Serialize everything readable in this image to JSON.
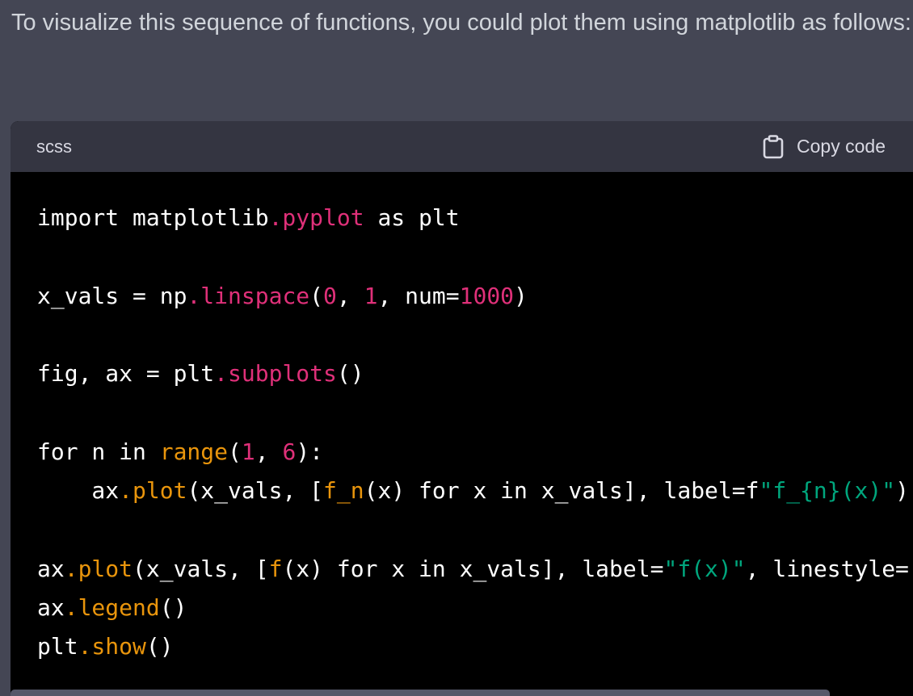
{
  "message": {
    "intro_text": "To visualize this sequence of functions, you could plot them using matplotlib as follows:"
  },
  "code_block": {
    "language": "scss",
    "copy_label": "Copy code",
    "copy_icon": "clipboard-icon",
    "lines": [
      [
        {
          "t": "import matplotlib",
          "c": ""
        },
        {
          "t": ".pyplot",
          "c": "fn"
        },
        {
          "t": " as plt",
          "c": ""
        }
      ],
      [],
      [
        {
          "t": "x_vals = np",
          "c": ""
        },
        {
          "t": ".linspace",
          "c": "fn"
        },
        {
          "t": "(",
          "c": ""
        },
        {
          "t": "0",
          "c": "num"
        },
        {
          "t": ", ",
          "c": ""
        },
        {
          "t": "1",
          "c": "num"
        },
        {
          "t": ", num=",
          "c": ""
        },
        {
          "t": "1000",
          "c": "num"
        },
        {
          "t": ")",
          "c": ""
        }
      ],
      [],
      [
        {
          "t": "fig, ax = plt",
          "c": ""
        },
        {
          "t": ".subplots",
          "c": "fn"
        },
        {
          "t": "()",
          "c": ""
        }
      ],
      [],
      [
        {
          "t": "for n in ",
          "c": ""
        },
        {
          "t": "range",
          "c": "builtin"
        },
        {
          "t": "(",
          "c": ""
        },
        {
          "t": "1",
          "c": "num"
        },
        {
          "t": ", ",
          "c": ""
        },
        {
          "t": "6",
          "c": "num"
        },
        {
          "t": "):",
          "c": ""
        }
      ],
      [
        {
          "t": "    ax",
          "c": ""
        },
        {
          "t": ".plot",
          "c": "builtin"
        },
        {
          "t": "(x_vals, [",
          "c": ""
        },
        {
          "t": "f_n",
          "c": "builtin"
        },
        {
          "t": "(x) for x in x_vals], label=f",
          "c": ""
        },
        {
          "t": "\"f_{n}(x)\"",
          "c": "str"
        },
        {
          "t": ")",
          "c": ""
        }
      ],
      [],
      [
        {
          "t": "ax",
          "c": ""
        },
        {
          "t": ".plot",
          "c": "builtin"
        },
        {
          "t": "(x_vals, [",
          "c": ""
        },
        {
          "t": "f",
          "c": "builtin"
        },
        {
          "t": "(x) for x in x_vals], label=",
          "c": ""
        },
        {
          "t": "\"f(x)\"",
          "c": "str"
        },
        {
          "t": ", linestyle=",
          "c": ""
        },
        {
          "t": "'",
          "c": "str"
        }
      ],
      [
        {
          "t": "ax",
          "c": ""
        },
        {
          "t": ".legend",
          "c": "builtin"
        },
        {
          "t": "()",
          "c": ""
        }
      ],
      [
        {
          "t": "plt",
          "c": ""
        },
        {
          "t": ".show",
          "c": "builtin"
        },
        {
          "t": "()",
          "c": ""
        }
      ]
    ]
  },
  "colors": {
    "page_background": "#444654",
    "code_background": "#000000",
    "header_background": "#343541",
    "function_pink": "#df3079",
    "builtin_orange": "#e9950c",
    "string_green": "#00a67d"
  }
}
